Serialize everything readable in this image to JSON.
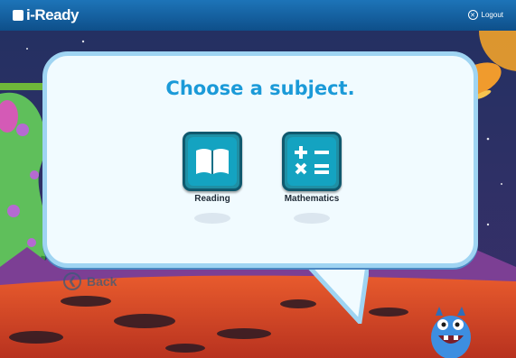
{
  "header": {
    "brand": "i-Ready",
    "logout_label": "Logout"
  },
  "prompt": {
    "title": "Choose a subject."
  },
  "subjects": [
    {
      "label": "Reading",
      "icon": "book-icon"
    },
    {
      "label": "Mathematics",
      "icon": "math-symbols-icon"
    }
  ],
  "nav": {
    "back_label": "Back"
  },
  "colors": {
    "header": "#1471b5",
    "title": "#1b9ad8",
    "tile": "#14a3c1",
    "bubble_border": "#9fd4f2",
    "arrow": "#6fb83a",
    "ground": "#e04b2a"
  }
}
